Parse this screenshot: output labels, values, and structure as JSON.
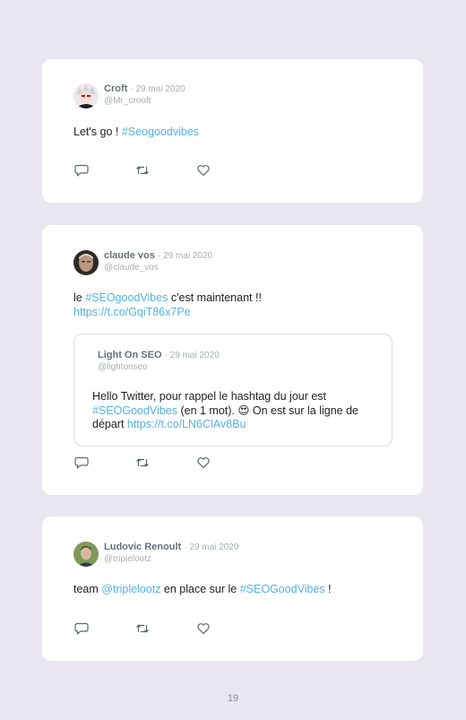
{
  "tweets": [
    {
      "name": "Croft",
      "date": "· 29 mai 2020",
      "handle": "@Mr_crooft",
      "text_plain": "Let's go ! ",
      "hashtag": "#Seogoodvibes",
      "avatar_icon": "avatar-anime-character"
    },
    {
      "name": "claude vos",
      "date": "· 29 mai 2020",
      "handle": "@claude_vos",
      "text_1": "le ",
      "hashtag": "#SEOgoodVibes",
      "text_2": " c'est maintenant !!",
      "link": "https://t.co/GqiT86x7Pe",
      "avatar_icon": "avatar-photo",
      "quote": {
        "name": "Light On SEO",
        "date": "· 29 mai 2020",
        "handle": "@lightonseo",
        "text_1": "Hello Twitter, pour rappel le hashtag du jour est ",
        "hashtag": "#SEOGoodVibes",
        "text_2": " (en 1 mot). ",
        "emoji": "😍",
        "text_3": " On est sur la ligne de départ ",
        "link": "https://t.co/LN6ClAv8Bu"
      }
    },
    {
      "name": "Ludovic Renoult",
      "date": "· 29 mai 2020",
      "handle": "@triplelootz",
      "text_1": "team ",
      "mention": "@triplelootz",
      "text_2": " en place sur le ",
      "hashtag": "#SEOGoodVibes",
      "text_3": " !",
      "avatar_icon": "avatar-photo"
    }
  ],
  "page_number": "19",
  "colors": {
    "link": "#52b3e6",
    "background": "#e9e6f1",
    "card": "#ffffff"
  }
}
